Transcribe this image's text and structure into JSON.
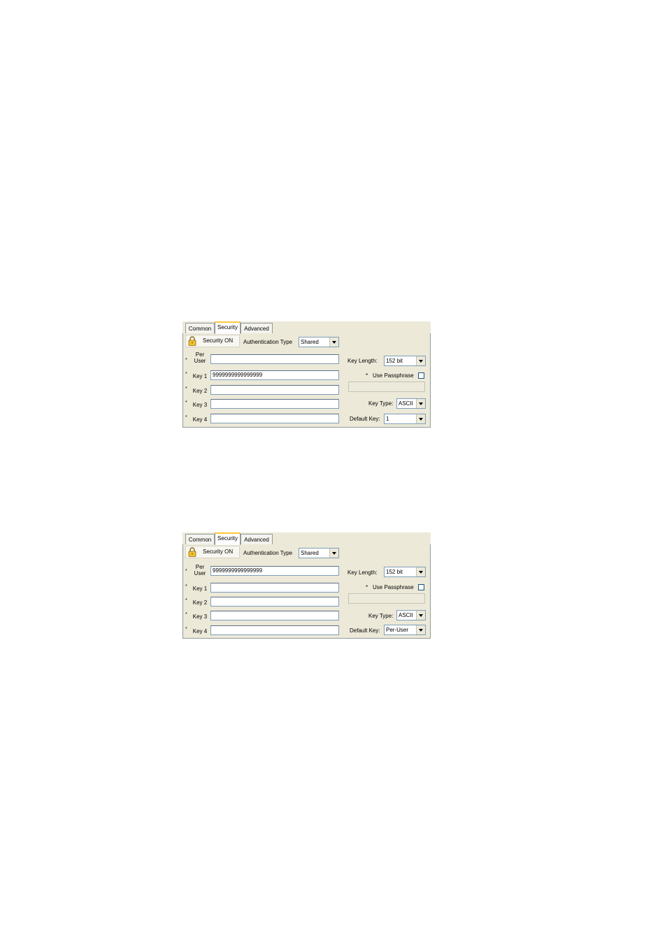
{
  "tabs": {
    "common": "Common",
    "security": "Security",
    "advanced": "Advanced"
  },
  "security_button": "Security ON",
  "auth_type_label": "Authentication Type",
  "auth_type_value": "Shared",
  "key_length_label": "Key Length:",
  "key_length_value": "152 bit",
  "use_passphrase_label": "Use Passphrase",
  "key_type_label": "Key Type:",
  "key_type_value": "ASCII",
  "default_key_label": "Default Key:",
  "star": "*",
  "rows": {
    "per_user": "Per User",
    "key1": "Key 1",
    "key2": "Key 2",
    "key3": "Key 3",
    "key4": "Key 4"
  },
  "panels": [
    {
      "per_user_value": "",
      "key1_value": "9999999999999999",
      "key2_value": "",
      "key3_value": "",
      "key4_value": "",
      "default_key_value": "1"
    },
    {
      "per_user_value": "9999999999999999",
      "key1_value": "",
      "key2_value": "",
      "key3_value": "",
      "key4_value": "",
      "default_key_value": "Per-User"
    }
  ],
  "colors": {
    "dialog_bg": "#ece9d8",
    "tab_highlight": "#ffc83c",
    "border": "#919b9c"
  },
  "icons": {
    "lock": "lock-icon",
    "dropdown": "chevron-down-icon"
  }
}
